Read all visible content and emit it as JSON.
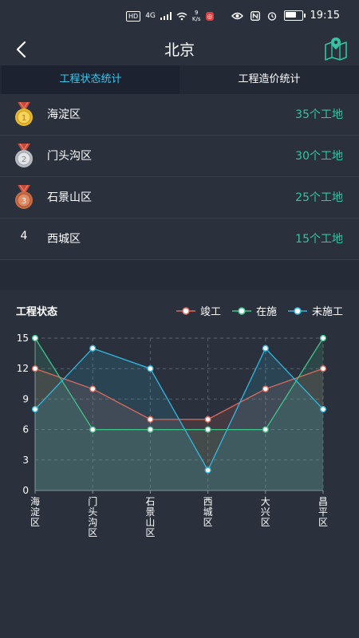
{
  "status_bar": {
    "network_badges": [
      "HD",
      "4G"
    ],
    "speed_value": "9",
    "speed_unit": "K/s",
    "time": "19:15",
    "battery_level_pct": 80
  },
  "header": {
    "title": "北京"
  },
  "tabs": [
    {
      "label": "工程状态统计",
      "active": true
    },
    {
      "label": "工程造价统计",
      "active": false
    }
  ],
  "ranking": [
    {
      "rank": "1",
      "medal": "gold",
      "name": "海淀区",
      "value": "35个工地"
    },
    {
      "rank": "2",
      "medal": "silver",
      "name": "门头沟区",
      "value": "30个工地"
    },
    {
      "rank": "3",
      "medal": "bronze",
      "name": "石景山区",
      "value": "25个工地"
    },
    {
      "rank": "4",
      "medal": "",
      "name": "西城区",
      "value": "15个工地"
    }
  ],
  "chart_section": {
    "title": "工程状态"
  },
  "colors": {
    "accent": "#3fc6e8",
    "value_green": "#36c2a3",
    "series_completed": "#e06a5c",
    "series_in_progress": "#3fc48a",
    "series_not_started": "#31b8e0"
  },
  "chart_data": {
    "type": "line",
    "categories": [
      "海淀区",
      "门头沟区",
      "石景山区",
      "西城区",
      "大兴区",
      "昌平区"
    ],
    "series": [
      {
        "name": "竣工",
        "values": [
          12,
          10,
          7,
          7,
          10,
          12
        ],
        "color": "#e06a5c"
      },
      {
        "name": "在施",
        "values": [
          15,
          6,
          6,
          6,
          6,
          15
        ],
        "color": "#3fc48a"
      },
      {
        "name": "未施工",
        "values": [
          8,
          14,
          12,
          2,
          14,
          8
        ],
        "color": "#31b8e0"
      }
    ],
    "yticks": [
      0,
      3,
      6,
      9,
      12,
      15
    ],
    "ylim": [
      0,
      15
    ],
    "grid": true,
    "legend_position": "top-right",
    "area_fill": true
  }
}
